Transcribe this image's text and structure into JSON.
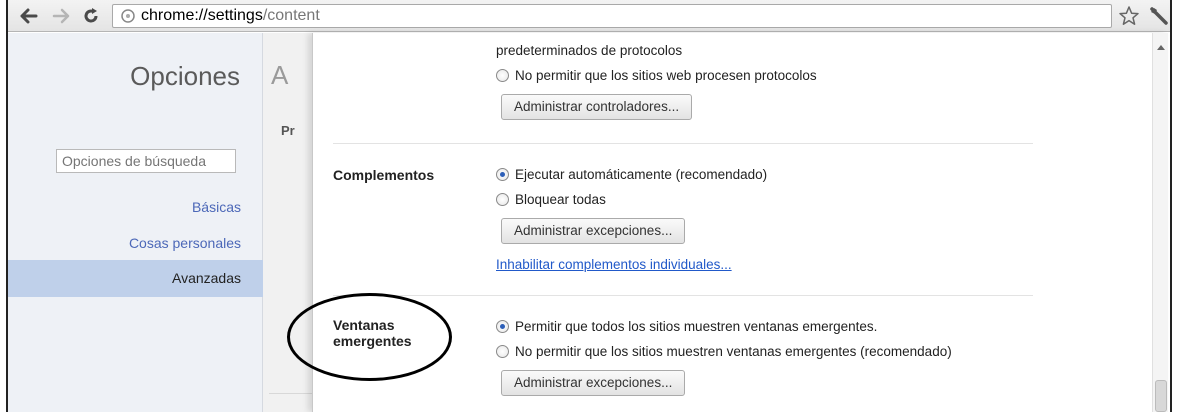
{
  "browser": {
    "url_host": "chrome://settings",
    "url_path": "/content",
    "icons": [
      "back-arrow-icon",
      "forward-arrow-icon",
      "reload-icon",
      "page-info-icon",
      "bookmark-star-icon",
      "wrench-icon"
    ]
  },
  "sidebar": {
    "title": "Opciones",
    "search_placeholder": "Opciones de búsqueda",
    "items": [
      {
        "label": "Básicas",
        "selected": false
      },
      {
        "label": "Cosas personales",
        "selected": false
      },
      {
        "label": "Avanzadas",
        "selected": true
      }
    ]
  },
  "background_page": {
    "heading": "A",
    "subheading": "Pr"
  },
  "content": {
    "protocols": {
      "partial_text": "predeterminados de protocolos",
      "option_deny": "No permitir que los sitios web procesen protocolos",
      "button": "Administrar controladores..."
    },
    "plugins": {
      "title": "Complementos",
      "options": [
        {
          "label": "Ejecutar automáticamente (recomendado)",
          "checked": true
        },
        {
          "label": "Bloquear todas",
          "checked": false
        }
      ],
      "button": "Administrar excepciones...",
      "link": "Inhabilitar complementos individuales..."
    },
    "popups": {
      "title_line1": "Ventanas",
      "title_line2": "emergentes",
      "options": [
        {
          "label": "Permitir que todos los sitios muestren ventanas emergentes.",
          "checked": true
        },
        {
          "label": "No permitir que los sitios muestren ventanas emergentes (recomendado)",
          "checked": false
        }
      ],
      "button": "Administrar excepciones..."
    }
  },
  "colors": {
    "link": "#2159c9",
    "sidebar_selected": "#bfd0ea",
    "sidebar_link": "#4c68b8"
  }
}
